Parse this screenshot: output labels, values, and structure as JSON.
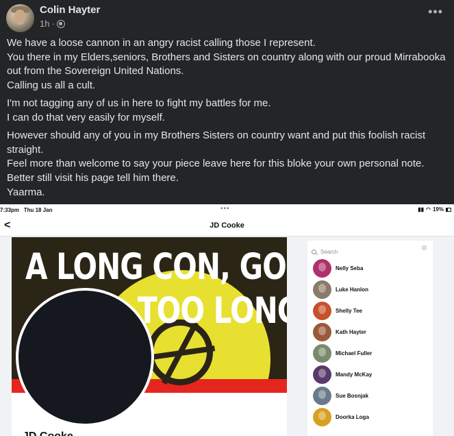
{
  "post": {
    "author": "Colin Hayter",
    "time": "1h",
    "separator": "·",
    "more": "•••",
    "paragraphs": [
      [
        "We have a loose cannon in an angry racist calling those I represent.",
        "You there in my Elders,seniors, Brothers and Sisters on country along with our proud Mirrabooka",
        "out from the Sovereign United Nations.",
        "Calling us all a cult."
      ],
      [
        "I'm not tagging any of us in here to fight my battles for me.",
        "I can do that very easily for myself."
      ],
      [
        "However should any of you in my Brothers Sisters on country want and put this foolish racist",
        "straight.",
        "Feel more than welcome to say your piece leave here for this bloke your own personal note.",
        "Better still visit his page tell him there.",
        "Yaarma."
      ]
    ]
  },
  "screenshot": {
    "status": {
      "time": "7:33pm",
      "date": "Thu 18 Jan",
      "dots": "•••",
      "battery": "19%"
    },
    "nav": {
      "back": "<",
      "title": "JD Cooke"
    },
    "cover": {
      "line1": "A LONG CON, GONE ON",
      "line2": "TOO LONG"
    },
    "profile_name": "JD Cooke",
    "chat": {
      "search_placeholder": "Search",
      "contacts": [
        {
          "name": "Nelly Seba",
          "color": "#b0306a"
        },
        {
          "name": "Luke Hanlon",
          "color": "#8a7a6a"
        },
        {
          "name": "Shelly Tee",
          "color": "#c8502a"
        },
        {
          "name": "Kath Hayter",
          "color": "#9a5a3a"
        },
        {
          "name": "Michael Fuller",
          "color": "#7a8a6a"
        },
        {
          "name": "Mandy McKay",
          "color": "#5a3a6a"
        },
        {
          "name": "Sue Bosnjak",
          "color": "#6a7a8a"
        },
        {
          "name": "Doorka Loga",
          "color": "#d8a020"
        }
      ]
    }
  }
}
